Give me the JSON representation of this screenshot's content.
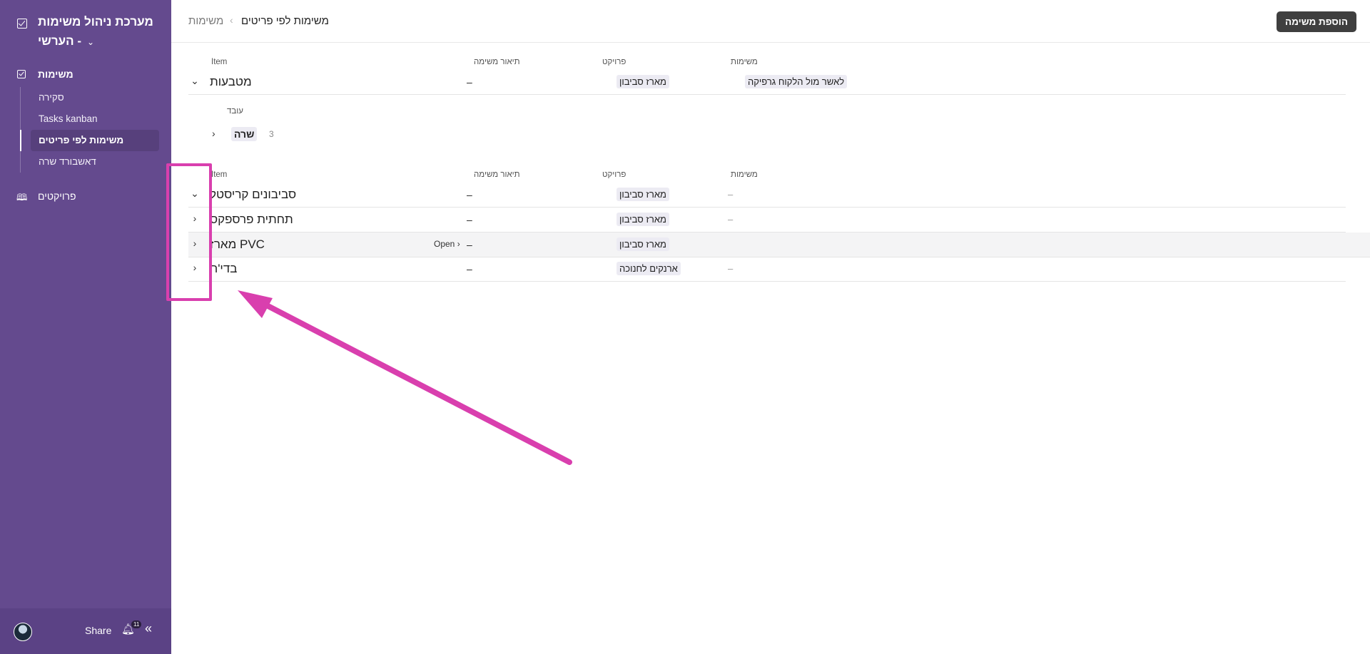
{
  "sidebar": {
    "app_title": "מערכת ניהול משימות",
    "app_subtitle": "הערשי -",
    "nav_tasks": "משימות",
    "subnav": [
      "סקירה",
      "Tasks kanban",
      "משימות לפי פריטים",
      "דאשבורד שרה"
    ],
    "nav_projects": "פרויקטים",
    "footer": {
      "share": "Share",
      "notification_count": "11"
    }
  },
  "header": {
    "crumb_root": "משימות",
    "crumb_separator": "‹",
    "crumb_current": "משימות לפי פריטים",
    "add_button": "הוספת משימה"
  },
  "table1": {
    "columns": {
      "item": "Item",
      "description": "תיאור משימה",
      "project": "פרויקט",
      "tasks": "משימות"
    },
    "rows": [
      {
        "title": "מטבעות",
        "description": "–",
        "project": "מארז סביבון",
        "tasks": "לאשר מול הלקוח גרפיקה"
      }
    ]
  },
  "group": {
    "label": "עובד",
    "name": "שרה",
    "count": "3"
  },
  "table2": {
    "columns": {
      "item": "Item",
      "description": "תיאור משימה",
      "project": "פרויקט",
      "tasks": "משימות"
    },
    "rows": [
      {
        "title": "סביבונים קריסטל",
        "description": "–",
        "project": "מארז סביבון",
        "tasks": "–"
      },
      {
        "title": "תחתית פרספקס",
        "description": "–",
        "project": "מארז סביבון",
        "tasks": "–"
      },
      {
        "title": "מארז PVC",
        "description": "–",
        "project": "מארז סביבון",
        "tasks": "",
        "open_label": "Open ›"
      },
      {
        "title": "בדי'ח",
        "description": "–",
        "project": "ארנקים לחנוכה",
        "tasks": "–"
      }
    ]
  },
  "colors": {
    "sidebar": "#644a8e",
    "annotation": "#d93fae"
  }
}
